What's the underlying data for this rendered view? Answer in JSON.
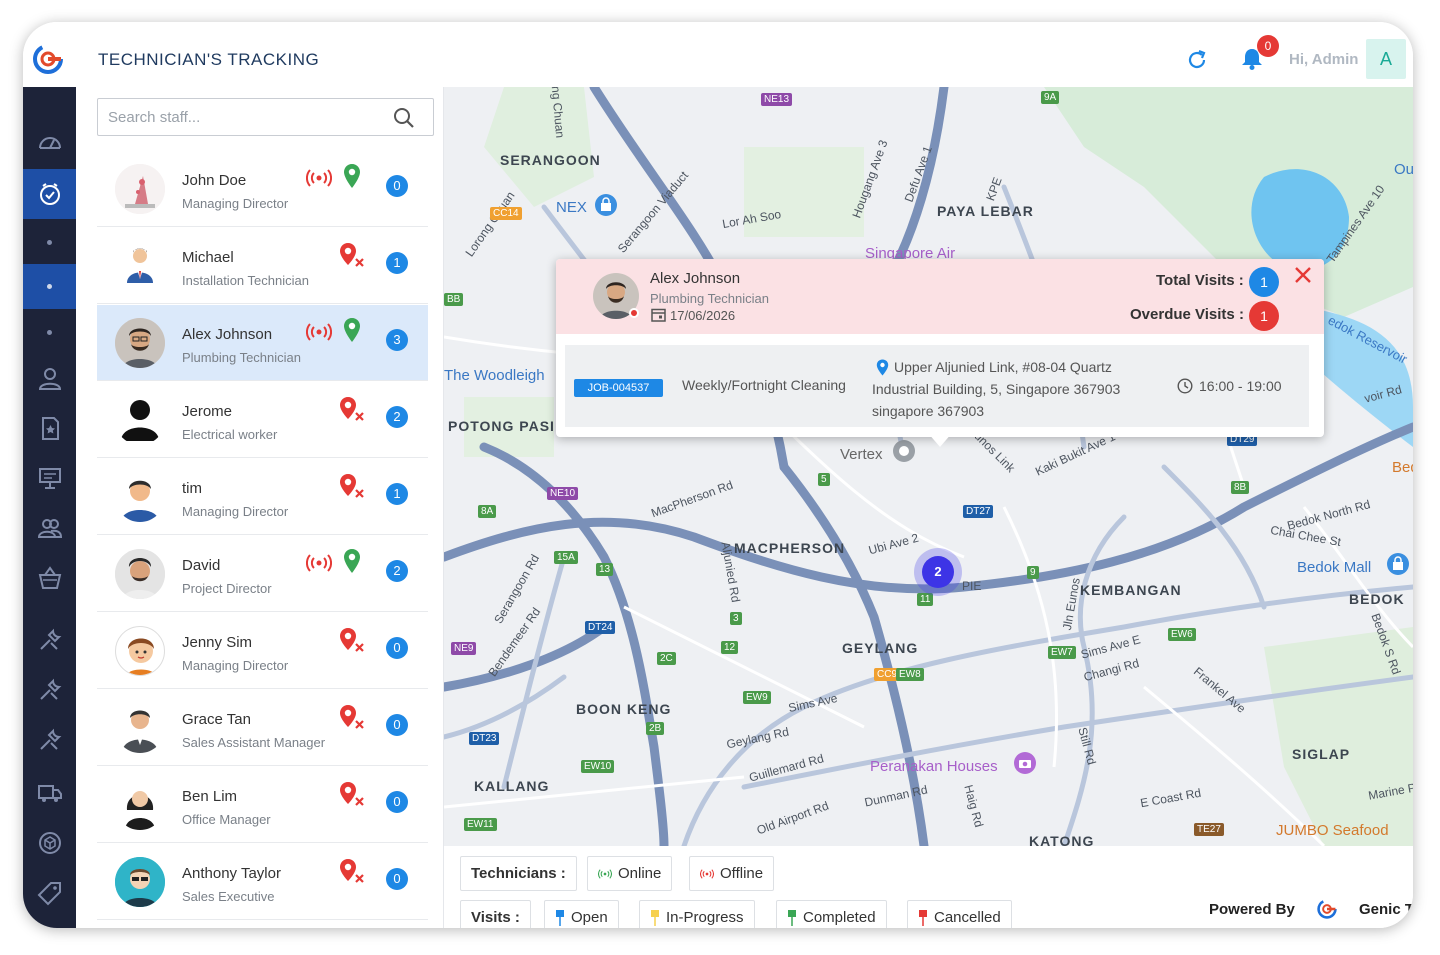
{
  "header": {
    "title": "TECHNICIAN'S TRACKING",
    "notification_count": "0",
    "greeting": "Hi, Admin",
    "avatar_initial": "A"
  },
  "search": {
    "placeholder": "Search staff..."
  },
  "staff": [
    {
      "name": "John Doe",
      "role": "Managing Director",
      "status": "online",
      "count": "0"
    },
    {
      "name": "Michael",
      "role": "Installation Technician",
      "status": "offline",
      "count": "1"
    },
    {
      "name": "Alex Johnson",
      "role": "Plumbing Technician",
      "status": "online",
      "count": "3",
      "selected": true
    },
    {
      "name": "Jerome",
      "role": "Electrical worker",
      "status": "offline",
      "count": "2"
    },
    {
      "name": "tim",
      "role": "Managing Director",
      "status": "offline",
      "count": "1"
    },
    {
      "name": "David",
      "role": "Project Director",
      "status": "online",
      "count": "2"
    },
    {
      "name": "Jenny Sim",
      "role": "Managing Director",
      "status": "offline",
      "count": "0"
    },
    {
      "name": "Grace Tan",
      "role": "Sales Assistant Manager",
      "status": "offline",
      "count": "0"
    },
    {
      "name": "Ben Lim",
      "role": "Office Manager",
      "status": "offline",
      "count": "0"
    },
    {
      "name": "Anthony Taylor",
      "role": "Sales Executive",
      "status": "offline",
      "count": "0"
    }
  ],
  "popup": {
    "name": "Alex Johnson",
    "role": "Plumbing Technician",
    "date": "17/06/2026",
    "total_visits_label": "Total Visits :",
    "total_visits": "1",
    "overdue_visits_label": "Overdue Visits :",
    "overdue_visits": "1",
    "job": {
      "id": "JOB-004537",
      "type": "Weekly/Fortnight Cleaning",
      "address_line1": "Upper Aljunied Link, #08-04 Quartz",
      "address_line2": "Industrial Building, 5, Singapore 367903",
      "address_line3": "singapore 367903",
      "time": "16:00 - 19:00"
    }
  },
  "map": {
    "cluster_count": "2",
    "labels": {
      "serangoon": "SERANGOON",
      "paya_lebar": "PAYA LEBAR",
      "potong_pasir": "POTONG PASI",
      "macpherson": "MACPHERSON",
      "kembangan": "KEMBANGAN",
      "bedok": "BEDOK",
      "geylang": "GEYLANG",
      "boon_keng": "BOON KENG",
      "kallang": "KALLANG",
      "siglap": "SIGLAP",
      "katong": "KATONG",
      "nex": "NEX",
      "singapore_air": "Singapore Air",
      "woodleigh": "The Woodleigh",
      "vertex": "Vertex",
      "bedok_mall": "Bedok Mall",
      "peranakan_houses": "Peranakan Houses",
      "jumbo": "JUMBO Seafood",
      "bed": "Bed",
      "ou": "Ou",
      "bedok_reservoir": "edok Reservoir",
      "lor_ah_soo": "Lor Ah Soo",
      "hougang_ave3": "Hougang Ave 3",
      "defu_ave1": "Defu Ave 1",
      "kpe": "KPE",
      "macpherson_rd": "MacPherson Rd",
      "aljunied_rd": "Aljunied Rd",
      "ubi_ave2": "Ubi Ave 2",
      "pie": "PIE",
      "sims_ave": "Sims Ave",
      "sims_ave_e": "Sims Ave E",
      "changi_rd": "Changi Rd",
      "geylang_rd": "Geylang Rd",
      "guillemard_rd": "Guillemard Rd",
      "dunman_rd": "Dunman Rd",
      "old_airport_rd": "Old Airport Rd",
      "e_coast_rd": "E Coast Rd",
      "marine_pa": "Marine Pa",
      "bedok_north_rd": "Bedok North Rd",
      "chai_chee": "Chai Chee St",
      "kaki_bukit": "Kaki Bukit Ave 1",
      "frankel": "Frankel Ave",
      "stil_rd": "Still Rd",
      "haig_rd": "Haig Rd",
      "bendemeer": "Bendemeer Rd",
      "serangoon_rd": "Serangoon Rd",
      "jln_eunos": "Jln Eunos",
      "tampines_ave10": "Tampines Ave 10",
      "upp_serangoon_viaduct": "Serangoon Viaduct",
      "lorong_chuan": "Lorong Chuan",
      "ng_chuan": "ng Chuan",
      "bedok_s_rd": "Bedok S Rd",
      "unos_link": "unos Link",
      "voir_rd": "voir Rd"
    },
    "stations": [
      "NE13",
      "9A",
      "CC14",
      "NE10",
      "8A",
      "15A",
      "13",
      "DT24",
      "NE9",
      "2C",
      "12",
      "EW9",
      "2B",
      "DT23",
      "EW10",
      "EW11",
      "CC9",
      "EW8",
      "EW7",
      "EW6",
      "DT27",
      "11",
      "9",
      "8B",
      "DT29",
      "TE27",
      "5",
      "BB",
      "3"
    ]
  },
  "legend": {
    "technicians_label": "Technicians :",
    "online": "Online",
    "offline": "Offline",
    "visits_label": "Visits :",
    "open": "Open",
    "in_progress": "In-Progress",
    "completed": "Completed",
    "cancelled": "Cancelled",
    "powered_by": "Powered By",
    "company": "Genic Tear"
  },
  "colors": {
    "nav_bg": "#1d2339",
    "nav_active": "#1e4fa6",
    "accent_blue": "#1e88e5",
    "alert_red": "#e53935",
    "online_green": "#3aa655",
    "popup_header": "#fbe1e4"
  },
  "icons": {
    "nav": [
      "dashboard-icon",
      "tracking-icon",
      "dot",
      "dot",
      "dot",
      "user-icon",
      "star-doc-icon",
      "presentation-icon",
      "team-icon",
      "basket-icon",
      "tools-icon",
      "tools-icon",
      "tools-icon",
      "truck-icon",
      "box-icon",
      "tag-icon"
    ]
  }
}
